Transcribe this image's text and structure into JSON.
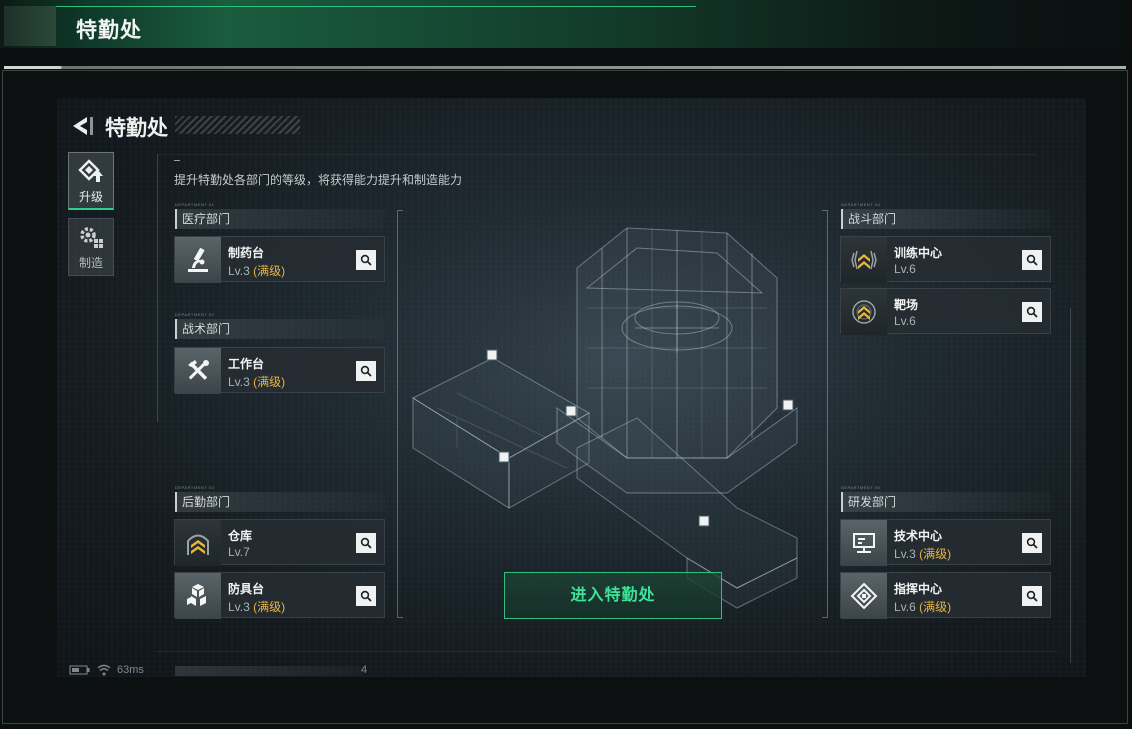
{
  "window": {
    "title": "特勤处"
  },
  "game": {
    "title": "特勤处",
    "tabs": [
      {
        "label": "升级",
        "icon": "upgrade-icon",
        "active": true
      },
      {
        "label": "制造",
        "icon": "gears-icon",
        "active": false
      }
    ],
    "description": "提升特勤处各部门的等级，将获得能力提升和制造能力",
    "departments": {
      "medical": {
        "name": "医疗部门",
        "tag": "DEPARTMENT 01",
        "items": [
          {
            "name": "制药台",
            "level": "Lv.3",
            "status": "(满级)",
            "icon": "microscope-icon"
          }
        ]
      },
      "tactical": {
        "name": "战术部门",
        "tag": "DEPARTMENT 02",
        "items": [
          {
            "name": "工作台",
            "level": "Lv.3",
            "status": "(满级)",
            "icon": "tools-icon"
          }
        ]
      },
      "logistics": {
        "name": "后勤部门",
        "tag": "DEPARTMENT 03",
        "items": [
          {
            "name": "仓库",
            "level": "Lv.7",
            "status": "",
            "icon": "chevron-rank-icon"
          },
          {
            "name": "防具台",
            "level": "Lv.3",
            "status": "(满级)",
            "icon": "cubes-icon"
          }
        ]
      },
      "combat": {
        "name": "战斗部门",
        "tag": "DEPARTMENT 04",
        "items": [
          {
            "name": "训练中心",
            "level": "Lv.6",
            "status": "",
            "icon": "training-icon"
          },
          {
            "name": "靶场",
            "level": "Lv.6",
            "status": "",
            "icon": "target-range-icon"
          }
        ]
      },
      "research": {
        "name": "研发部门",
        "tag": "DEPARTMENT 05",
        "items": [
          {
            "name": "技术中心",
            "level": "Lv.3",
            "status": "(满级)",
            "icon": "computer-icon"
          },
          {
            "name": "指挥中心",
            "level": "Lv.6",
            "status": "(满级)",
            "icon": "command-icon"
          }
        ]
      }
    },
    "enter_button": "进入特勤处",
    "status": {
      "ping": "63ms",
      "counter": "4"
    }
  },
  "colors": {
    "accent": "#2fd08a",
    "maxed": "#e6b540",
    "enter_text": "#3ee39a"
  }
}
